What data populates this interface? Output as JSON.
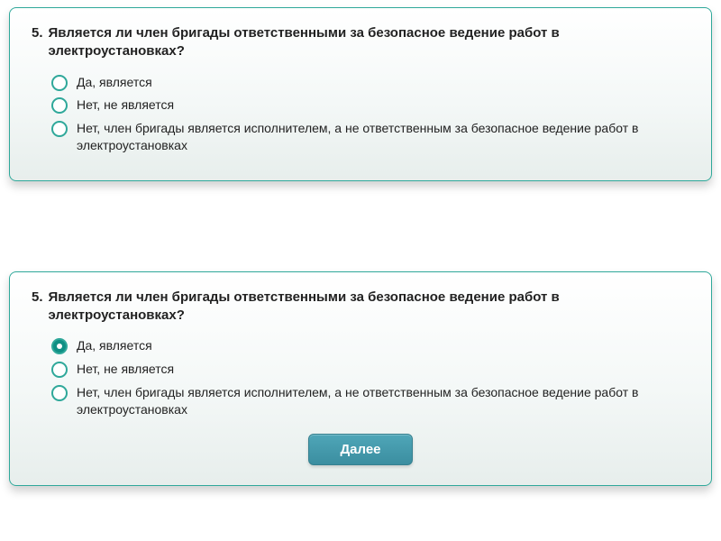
{
  "card1": {
    "number": "5.",
    "question": "Является ли член бригады ответственными за безопасное ведение работ в электроустановках?",
    "options": [
      "Да, является",
      "Нет, не является",
      "Нет, член бригады является исполнителем, а не ответственным за безопасное ведение работ в электроустановках"
    ],
    "selected": null
  },
  "card2": {
    "number": "5.",
    "question": "Является ли член бригады ответственными за безопасное ведение работ в электроустановках?",
    "options": [
      "Да, является",
      "Нет, не является",
      "Нет, член бригады является исполнителем, а не ответственным за безопасное ведение работ в электроустановках"
    ],
    "selected": 0,
    "button": "Далее"
  }
}
